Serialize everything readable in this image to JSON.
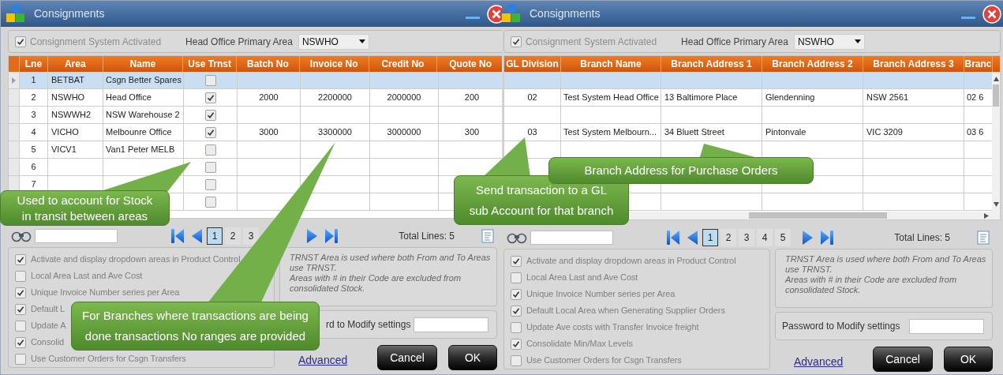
{
  "windows": [
    {
      "title": "Consignments",
      "activated": {
        "label": "Consignment System Activated",
        "checked": true
      },
      "primary_area": {
        "label": "Head Office Primary Area",
        "value": "NSWHO"
      },
      "table": {
        "row_indicator": true,
        "columns": [
          {
            "label": "Lne",
            "kind": "text"
          },
          {
            "label": "Area",
            "kind": "text"
          },
          {
            "label": "Name",
            "kind": "text"
          },
          {
            "label": "Use Trnst",
            "kind": "check"
          },
          {
            "label": "Batch No",
            "kind": "text"
          },
          {
            "label": "Invoice No",
            "kind": "text"
          },
          {
            "label": "Credit No",
            "kind": "text"
          },
          {
            "label": "Quote No",
            "kind": "text"
          }
        ],
        "rows": [
          {
            "selected": true,
            "cells": [
              "1",
              "BETBAT",
              "Csgn Better Spares",
              false,
              null,
              null,
              null,
              null
            ]
          },
          {
            "selected": false,
            "cells": [
              "2",
              "NSWHO",
              "Head Office",
              true,
              "2000",
              "2200000",
              "2000000",
              "200"
            ]
          },
          {
            "selected": false,
            "cells": [
              "3",
              "NSWWH2",
              "NSW Warehouse 2",
              true,
              null,
              null,
              null,
              null
            ]
          },
          {
            "selected": false,
            "cells": [
              "4",
              "VICHO",
              "Melbounre Office",
              true,
              "3000",
              "3300000",
              "3000000",
              "300"
            ]
          },
          {
            "selected": false,
            "cells": [
              "5",
              "VICV1",
              "Van1 Peter MELB",
              false,
              null,
              null,
              null,
              null
            ]
          },
          {
            "selected": false,
            "cells": [
              "6",
              null,
              null,
              false,
              null,
              null,
              null,
              null
            ]
          },
          {
            "selected": false,
            "cells": [
              "7",
              null,
              null,
              false,
              null,
              null,
              null,
              null
            ]
          },
          {
            "selected": false,
            "cells": [
              null,
              null,
              null,
              false,
              null,
              null,
              null,
              null
            ]
          }
        ]
      },
      "pager": {
        "pages": [
          {
            "label": "1",
            "selected": true
          },
          {
            "label": "2",
            "selected": false
          },
          {
            "label": "3",
            "selected": false
          }
        ],
        "total": "Total Lines: 5"
      },
      "options": [
        {
          "label": "Activate and display dropdown areas in Product Control",
          "checked": true
        },
        {
          "label": "Local Area Last and Ave Cost",
          "checked": false
        },
        {
          "label": "Unique Invoice Number series per Area",
          "checked": true
        },
        {
          "label": "Default L",
          "checked": true
        },
        {
          "label": "Update A",
          "checked": false
        },
        {
          "label": "Consolid",
          "checked": true
        },
        {
          "label": "Use Customer Orders for Csgn Transfers",
          "checked": false
        }
      ],
      "note": [
        "TRNST Area is used where both From and To Areas use TRNST.",
        "Areas with # in their Code are excluded from consolidated Stock."
      ],
      "password": {
        "label": "rd to Modify settings"
      },
      "link": "Advanced",
      "buttons": [
        "Cancel",
        "OK"
      ]
    },
    {
      "title": "Consignments",
      "activated": {
        "label": "Consignment System Activated",
        "checked": true
      },
      "primary_area": {
        "label": "Head Office Primary Area",
        "value": "NSWHO"
      },
      "table": {
        "columns": [
          {
            "label": "GL Division",
            "kind": "text"
          },
          {
            "label": "Branch Name",
            "kind": "text"
          },
          {
            "label": "Branch Address 1",
            "kind": "text"
          },
          {
            "label": "Branch Address 2",
            "kind": "text"
          },
          {
            "label": "Branch Address 3",
            "kind": "text"
          },
          {
            "label": "Branc",
            "kind": "text"
          }
        ],
        "rows": [
          {
            "selected": true,
            "cells": [
              null,
              null,
              null,
              null,
              null,
              null
            ]
          },
          {
            "selected": false,
            "cells": [
              "02",
              "Test System Head Office",
              "13 Baltimore Place",
              "Glendenning",
              "NSW 2561",
              "02 6"
            ]
          },
          {
            "selected": false,
            "cells": [
              null,
              null,
              null,
              null,
              null,
              null
            ]
          },
          {
            "selected": false,
            "cells": [
              "03",
              "Test System Melbourn...",
              "34 Bluett Street",
              "Pintonvale",
              "VIC 3209",
              "03 6"
            ]
          }
        ]
      },
      "pager": {
        "pages": [
          {
            "label": "1",
            "selected": true
          },
          {
            "label": "2",
            "selected": false
          },
          {
            "label": "3",
            "selected": false
          },
          {
            "label": "4",
            "selected": false
          },
          {
            "label": "5",
            "selected": false
          }
        ],
        "total": "Total Lines: 5"
      },
      "options": [
        {
          "label": "Activate and display dropdown areas in Product Control",
          "checked": true
        },
        {
          "label": "Local Area Last and Ave Cost",
          "checked": false
        },
        {
          "label": "Unique Invoice Number series per Area",
          "checked": true
        },
        {
          "label": "Default Local Area when Generating Supplier Orders",
          "checked": true
        },
        {
          "label": "Update Ave costs with Transfer Invoice freight",
          "checked": false
        },
        {
          "label": "Consolidate Min/Max Levels",
          "checked": true
        },
        {
          "label": "Use Customer Orders for Csgn Transfers",
          "checked": false
        }
      ],
      "note": [
        "TRNST Area is used where both From and To Areas use TRNST.",
        "Areas with # in their Code are excluded from consolidated Stock."
      ],
      "password": {
        "label": "Password to Modify settings"
      },
      "link": "Advanced",
      "buttons": [
        "Cancel",
        "OK"
      ]
    }
  ],
  "callouts": [
    {
      "lines": [
        "Used to account for Stock",
        "in transit between areas"
      ]
    },
    {
      "lines": [
        "For Branches where transactions are being",
        "done transactions No ranges are provided"
      ]
    },
    {
      "lines": [
        "Send transaction to a GL",
        "sub Account for that branch"
      ]
    },
    {
      "lines": [
        "Branch Address for Purchase Orders"
      ]
    }
  ]
}
